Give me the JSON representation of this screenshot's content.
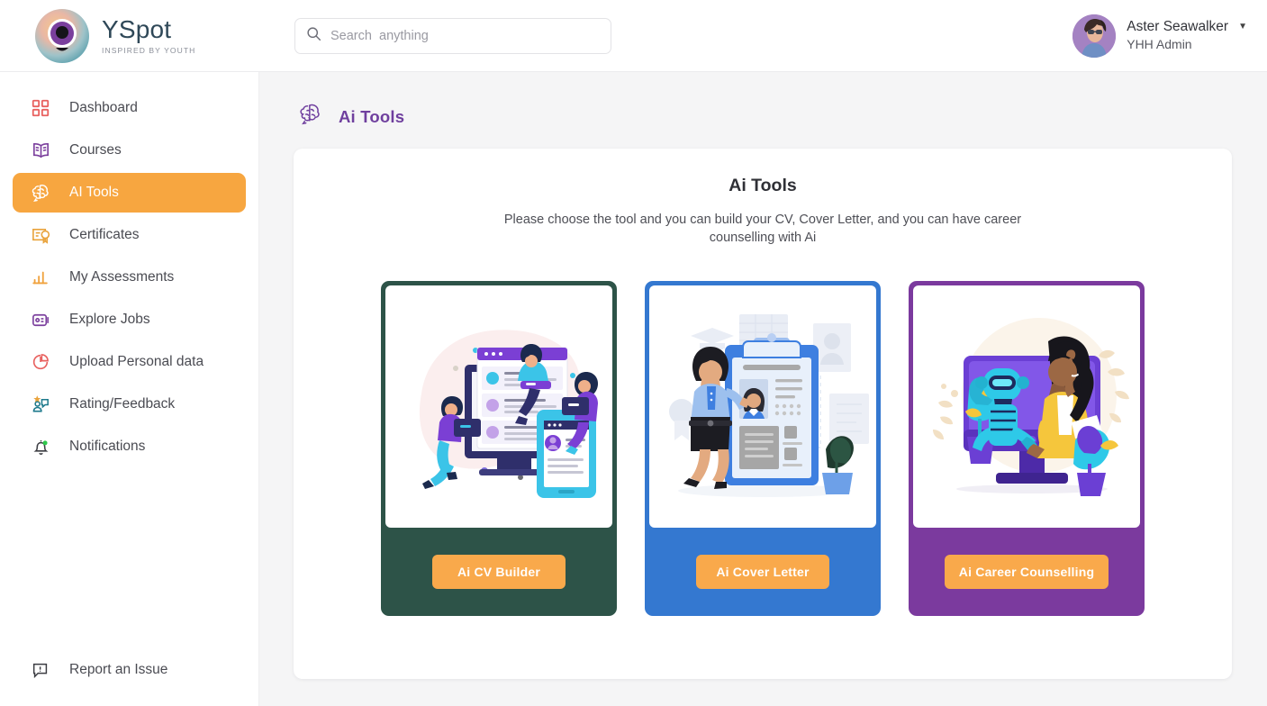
{
  "brand": {
    "name": "YSpot",
    "tagline": "INSPIRED BY YOUTH",
    "logo_icon": "eye-logo-icon"
  },
  "search": {
    "placeholder": "Search  anything",
    "value": "",
    "icon": "search-icon"
  },
  "user": {
    "name": "Aster Seawalker",
    "role": "YHH Admin",
    "caret": "▼",
    "avatar_icon": "user-avatar"
  },
  "sidebar": {
    "items": [
      {
        "label": "Dashboard",
        "icon": "grid-icon",
        "active": false,
        "color": "#e8615f"
      },
      {
        "label": "Courses",
        "icon": "book-icon",
        "active": false,
        "color": "#7b3f9d"
      },
      {
        "label": "AI Tools",
        "icon": "brain-icon",
        "active": true,
        "color": "#ffffff"
      },
      {
        "label": "Certificates",
        "icon": "certificate-icon",
        "active": false,
        "color": "#e9a33c"
      },
      {
        "label": "My Assessments",
        "icon": "bar-chart-icon",
        "active": false,
        "color": "#f0a23e"
      },
      {
        "label": "Explore Jobs",
        "icon": "id-card-icon",
        "active": false,
        "color": "#7b3f9d"
      },
      {
        "label": "Upload Personal data",
        "icon": "pie-chart-icon",
        "active": false,
        "color": "#e8615f"
      },
      {
        "label": "Rating/Feedback",
        "icon": "feedback-icon",
        "active": false,
        "color": "#1d7a8c"
      },
      {
        "label": "Notifications",
        "icon": "bell-icon",
        "active": false,
        "color": "#3b3c42"
      }
    ],
    "bottom": {
      "label": "Report an Issue",
      "icon": "report-issue-icon",
      "color": "#3b3c42"
    },
    "active_color": "#f7a640"
  },
  "page": {
    "header_title": "Ai Tools",
    "header_icon": "brain-icon",
    "header_color": "#6f3f9e"
  },
  "panel": {
    "title": "Ai Tools",
    "description": "Please choose the tool and you can build your CV, Cover Letter, and you can have career counselling with Ai"
  },
  "tools": [
    {
      "button_label": "Ai CV Builder",
      "frame_color": "#2d5348",
      "illustration": "cv-builder-illustration"
    },
    {
      "button_label": "Ai Cover Letter",
      "frame_color": "#3478d0",
      "illustration": "cover-letter-illustration"
    },
    {
      "button_label": "Ai Career Counselling",
      "frame_color": "#7b3a9e",
      "illustration": "career-counselling-illustration"
    }
  ],
  "colors": {
    "accent_orange": "#f9a94b",
    "page_bg": "#f5f5f6",
    "purple": "#6f3f9e"
  }
}
